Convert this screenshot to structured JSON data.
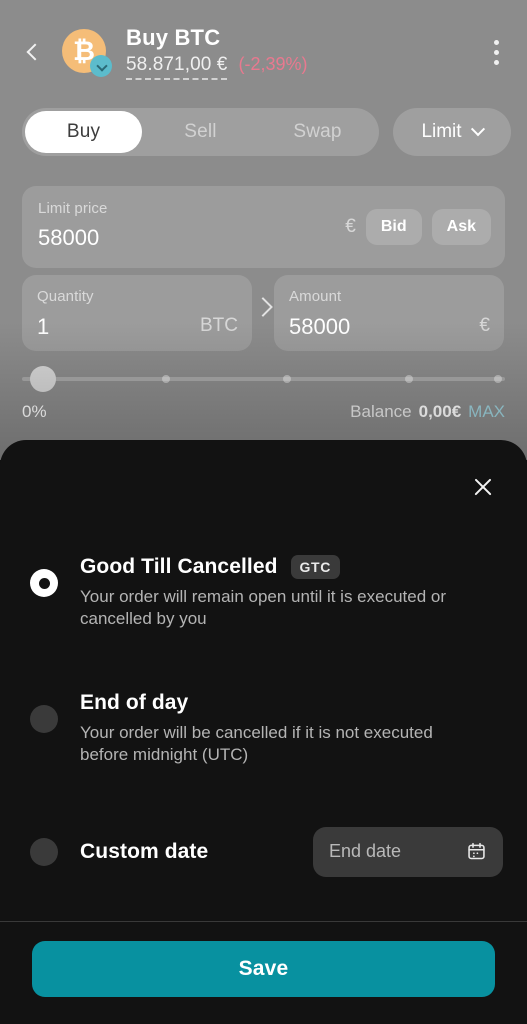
{
  "colors": {
    "accent_teal": "#0891a0",
    "coin_orange": "#f5bd78",
    "badge_teal": "#5cbccc",
    "negative_pink": "#e8798f",
    "max_blue": "#9fd3de",
    "sheet_bg": "#121212"
  },
  "header": {
    "back_label": "Back",
    "coin_symbol": "₿",
    "title": "Buy BTC",
    "price": "58.871,00 €",
    "change_pct": "(-2,39%)",
    "menu_label": "More options"
  },
  "tabs": {
    "items": [
      {
        "label": "Buy",
        "active": true
      },
      {
        "label": "Sell",
        "active": false
      },
      {
        "label": "Swap",
        "active": false
      }
    ],
    "order_type": "Limit"
  },
  "form": {
    "limit_price": {
      "label": "Limit price",
      "value": "58000",
      "currency": "€"
    },
    "bid_label": "Bid",
    "ask_label": "Ask",
    "quantity": {
      "label": "Quantity",
      "value": "1",
      "unit": "BTC"
    },
    "amount": {
      "label": "Amount",
      "value": "58000",
      "unit": "€"
    }
  },
  "slider": {
    "percent_label": "0%",
    "balance_label": "Balance",
    "balance_value": "0,00€",
    "max_label": "MAX",
    "ticks": [
      0,
      25,
      50,
      75,
      100
    ],
    "thumb_position": 0
  },
  "sheet": {
    "close_label": "Close",
    "options": [
      {
        "title": "Good Till Cancelled",
        "badge": "GTC",
        "description": "Your order will remain open until it is executed or cancelled by you",
        "selected": true
      },
      {
        "title": "End of day",
        "badge": "",
        "description": "Your order will be cancelled if it is not executed before midnight (UTC)",
        "selected": false
      },
      {
        "title": "Custom date",
        "badge": "",
        "description": "",
        "selected": false,
        "date_placeholder": "End date"
      }
    ],
    "save_label": "Save"
  }
}
